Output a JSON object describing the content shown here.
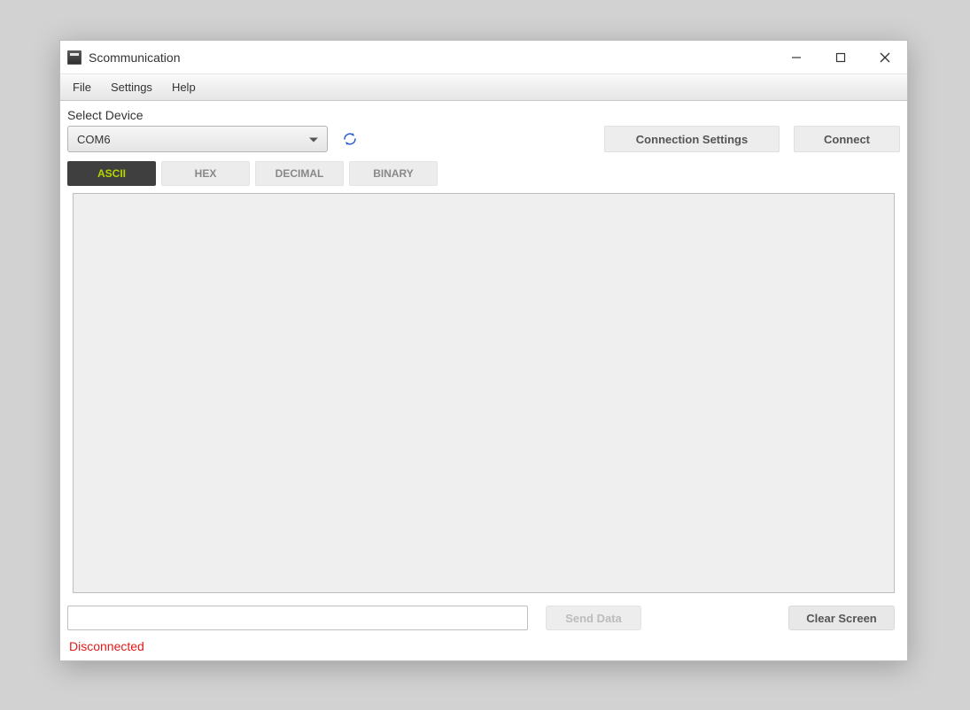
{
  "window": {
    "title": "Scommunication"
  },
  "menubar": {
    "items": [
      "File",
      "Settings",
      "Help"
    ]
  },
  "toolbar": {
    "select_label": "Select Device",
    "device_value": "COM6",
    "connection_settings": "Connection Settings",
    "connect": "Connect"
  },
  "tabs": {
    "items": [
      "ASCII",
      "HEX",
      "DECIMAL",
      "BINARY"
    ],
    "active_index": 0
  },
  "bottom": {
    "input_value": "",
    "send_label": "Send Data",
    "clear_label": "Clear Screen"
  },
  "status": {
    "text": "Disconnected",
    "color": "#e11a1a"
  }
}
